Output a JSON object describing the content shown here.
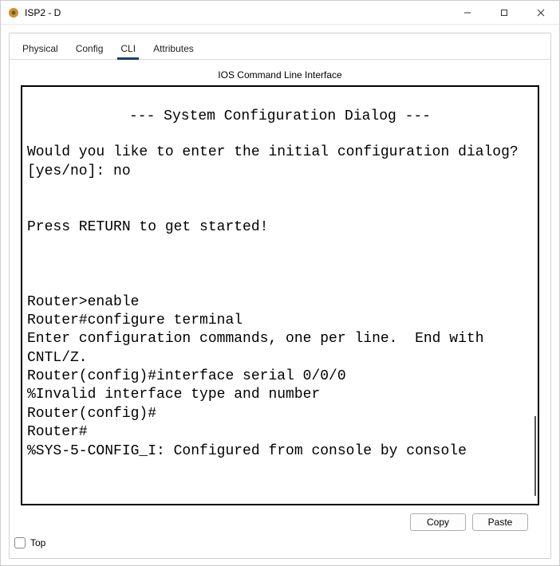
{
  "window": {
    "title": "ISP2 - D"
  },
  "tabs": {
    "items": [
      {
        "label": "Physical"
      },
      {
        "label": "Config"
      },
      {
        "label": "CLI"
      },
      {
        "label": "Attributes"
      }
    ],
    "active_index": 2
  },
  "cli": {
    "caption": "IOS Command Line Interface",
    "banner": "--- System Configuration Dialog ---",
    "prompt_block1": "Would you like to enter the initial configuration dialog? [yes/no]: no",
    "prompt_block2": "Press RETURN to get started!",
    "session": "Router>enable\nRouter#configure terminal\nEnter configuration commands, one per line.  End with CNTL/Z.\nRouter(config)#interface serial 0/0/0\n%Invalid interface type and number\nRouter(config)#\nRouter#\n%SYS-5-CONFIG_I: Configured from console by console"
  },
  "buttons": {
    "copy": "Copy",
    "paste": "Paste"
  },
  "footer": {
    "top_label": "Top",
    "top_checked": false
  }
}
